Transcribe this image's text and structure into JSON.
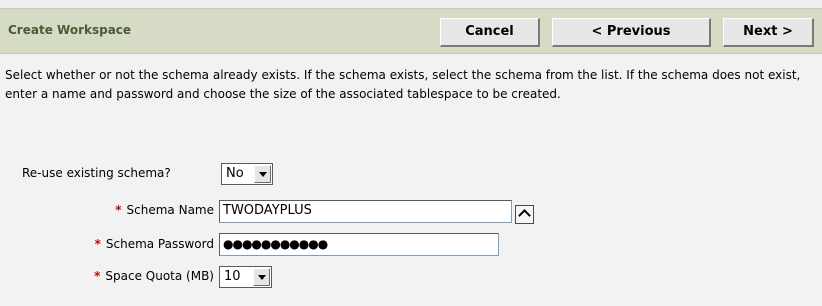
{
  "header": {
    "title": "Create Workspace",
    "cancel_label": "Cancel",
    "previous_label": "< Previous",
    "next_label": "Next >"
  },
  "instructions": "Select whether or not the schema already exists. If the schema exists, select the schema from the list. If the schema does not exist, enter a name and password and choose the size of the associated tablespace to be created.",
  "form": {
    "reuse_label": "Re-use existing schema?",
    "reuse_value": "No",
    "schema_name_label": "Schema Name",
    "schema_name_value": "TWODAYPLUS",
    "schema_password_label": "Schema Password",
    "schema_password_mask": "●●●●●●●●●●●",
    "space_quota_label": "Space Quota (MB)",
    "space_quota_value": "10",
    "required_marker": "*"
  },
  "colors": {
    "header_bg": "#d5dbc5",
    "title_color": "#4d5a36",
    "required_color": "#cc0000"
  }
}
